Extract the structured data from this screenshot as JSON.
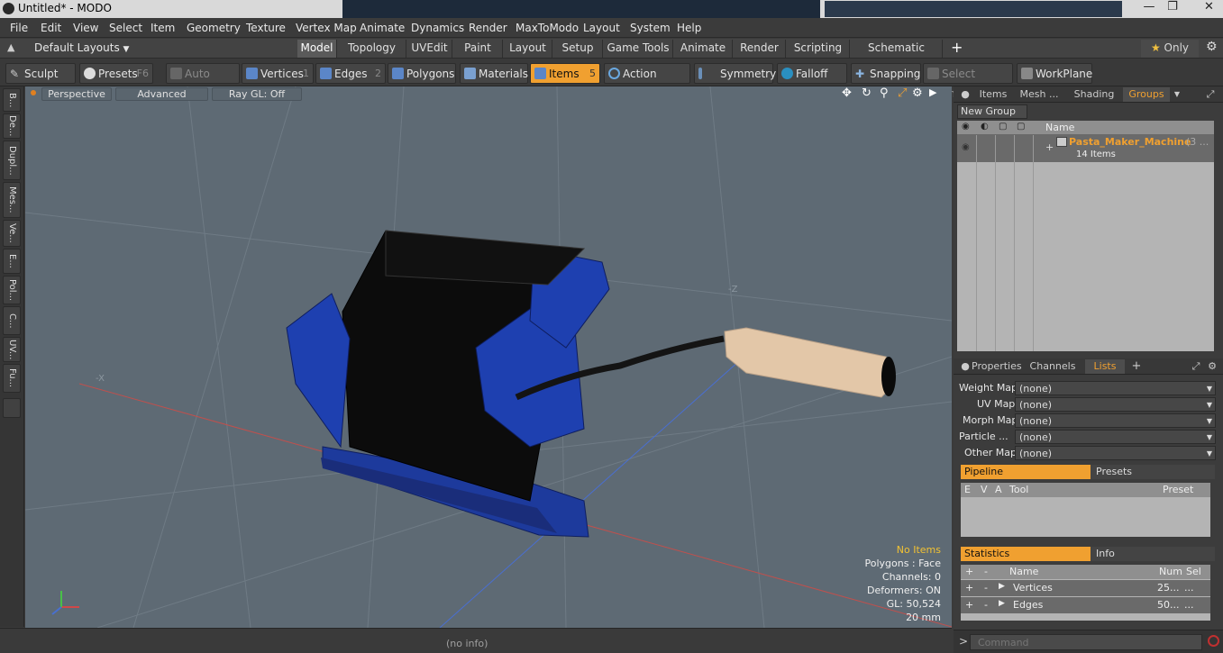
{
  "window": {
    "title": "Untitled* - MODO",
    "controls": [
      "minimize",
      "maximize",
      "close"
    ]
  },
  "menu": [
    "File",
    "Edit",
    "View",
    "Select",
    "Item",
    "Geometry",
    "Texture",
    "Vertex Map",
    "Animate",
    "Dynamics",
    "Render",
    "MaxToModo",
    "Layout",
    "System",
    "Help"
  ],
  "layoutbar": {
    "layouts_label": "Default Layouts",
    "tabs": [
      "Model",
      "Topology",
      "UVEdit",
      "Paint",
      "Layout",
      "Setup",
      "Game Tools",
      "Animate",
      "Render",
      "Scripting",
      "Schematic Fusion"
    ],
    "active_tab": "Model",
    "only_label": "Only"
  },
  "toolbar": {
    "sculpt": "Sculpt",
    "presets": "Presets",
    "presets_key": "F6",
    "auto_select": "Auto Select",
    "vertices": "Vertices",
    "vertices_key": "1",
    "edges": "Edges",
    "edges_key": "2",
    "polygons": "Polygons",
    "materials": "Materials",
    "items": "Items",
    "items_key": "5",
    "action_center": "Action Center",
    "symmetry": "Symmetry",
    "falloff": "Falloff",
    "snapping": "Snapping",
    "select_through": "Select Through",
    "workplane": "WorkPlane"
  },
  "left_tabs": [
    "B...",
    "De...",
    "Dupl...",
    "Mes...",
    "Ve...",
    "E...",
    "Pol...",
    "C...",
    "UV...",
    "Fu..."
  ],
  "viewport": {
    "view_mode": "Perspective",
    "shading": "Advanced",
    "raygl": "Ray GL: Off",
    "axis_labels": {
      "neg_z": "-Z",
      "neg_x": "-X"
    },
    "hud": {
      "no_items": "No Items",
      "polygons": "Polygons : Face",
      "channels": "Channels: 0",
      "deformers": "Deformers: ON",
      "gl": "GL: 50,524",
      "scale": "20 mm"
    },
    "colors": {
      "background": "#5e6a74",
      "body": "#1e3ea8",
      "handle": "#e3c7a8"
    }
  },
  "status": {
    "info": "(no info)"
  },
  "groups_panel": {
    "tabs": [
      "Items",
      "Mesh ...",
      "Shading",
      "Groups"
    ],
    "active_tab": "Groups",
    "new_group": "New Group",
    "col_name": "Name",
    "group_name": "Pasta_Maker_Machine",
    "group_suffix": "(3 ...",
    "group_count": "14 Items"
  },
  "props_panel": {
    "tabs": [
      "Properties",
      "Channels",
      "Lists"
    ],
    "active_tab": "Lists",
    "maps": [
      {
        "label": "Weight Map",
        "value": "(none)"
      },
      {
        "label": "UV Map",
        "value": "(none)"
      },
      {
        "label": "Morph Map",
        "value": "(none)"
      },
      {
        "label": "Particle",
        "label2": "...",
        "value": "(none)"
      },
      {
        "label": "Other Map",
        "value": "(none)"
      }
    ],
    "pipeline": "Pipeline",
    "presets": "Presets",
    "pipeline_cols": [
      "E",
      "V",
      "A",
      "Tool",
      "Preset"
    ],
    "statistics": "Statistics",
    "info": "Info",
    "stats_cols": [
      "+",
      "-",
      "Name",
      "Num",
      "Sel"
    ],
    "stats_rows": [
      {
        "plus": "+",
        "minus": "-",
        "name": "Vertices",
        "num": "25...",
        "sel": "..."
      },
      {
        "plus": "+",
        "minus": "-",
        "name": "Edges",
        "num": "50...",
        "sel": "..."
      }
    ]
  },
  "command": {
    "prompt": ">",
    "placeholder": "Command"
  }
}
